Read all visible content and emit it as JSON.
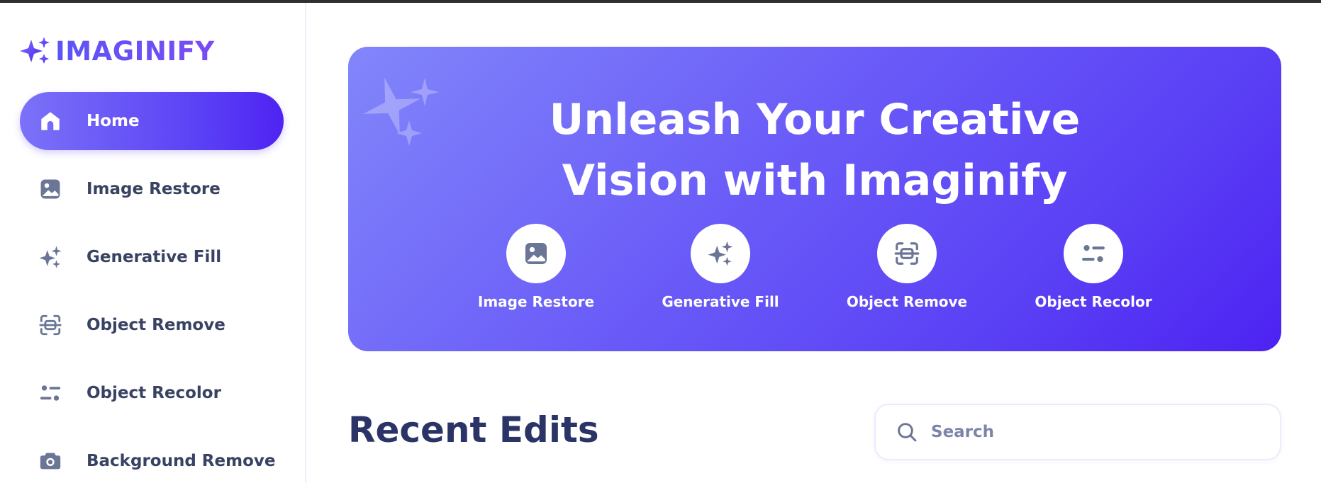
{
  "app": {
    "logo_text": "IMAGINIFY"
  },
  "sidebar": {
    "items": [
      {
        "label": "Home",
        "icon": "home-icon",
        "active": true
      },
      {
        "label": "Image Restore",
        "icon": "image-icon",
        "active": false
      },
      {
        "label": "Generative Fill",
        "icon": "stars-icon",
        "active": false
      },
      {
        "label": "Object Remove",
        "icon": "scan-icon",
        "active": false
      },
      {
        "label": "Object Recolor",
        "icon": "filter-icon",
        "active": false
      },
      {
        "label": "Background Remove",
        "icon": "camera-icon",
        "active": false
      }
    ]
  },
  "hero": {
    "title_line1": "Unleash Your Creative",
    "title_line2": "Vision with Imaginify",
    "actions": [
      {
        "label": "Image Restore",
        "icon": "image-icon"
      },
      {
        "label": "Generative Fill",
        "icon": "stars-icon"
      },
      {
        "label": "Object Remove",
        "icon": "scan-icon"
      },
      {
        "label": "Object Recolor",
        "icon": "filter-icon"
      }
    ]
  },
  "main": {
    "recent_title": "Recent Edits",
    "search": {
      "placeholder": "Search",
      "value": ""
    }
  },
  "colors": {
    "accent": "#5a3ff5",
    "text_dark": "#2b3467",
    "text_nav": "#384262",
    "icon_gray": "#7c85a8"
  }
}
